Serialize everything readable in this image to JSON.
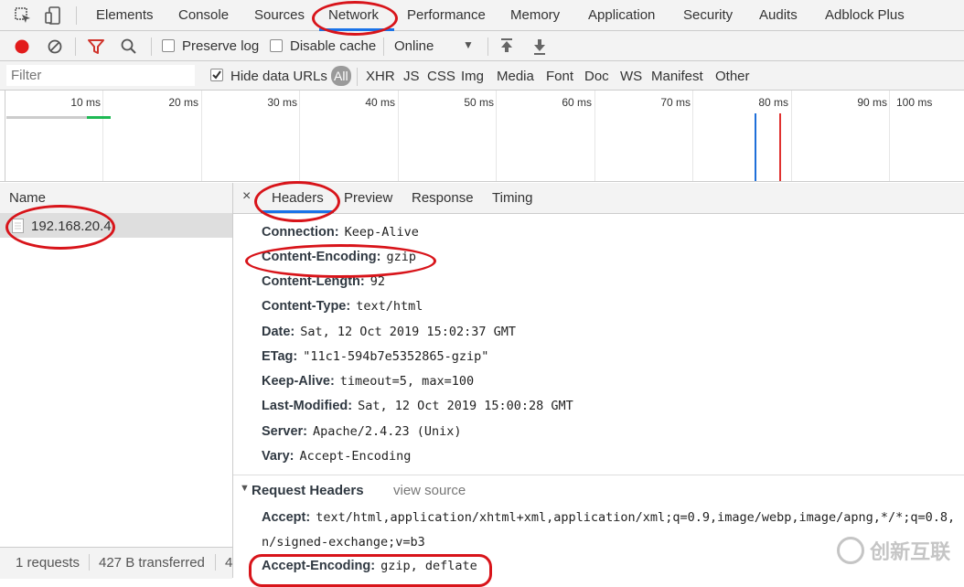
{
  "tabs": [
    "Elements",
    "Console",
    "Sources",
    "Network",
    "Performance",
    "Memory",
    "Application",
    "Security",
    "Audits",
    "Adblock Plus"
  ],
  "toolbar": {
    "preserve_log": "Preserve log",
    "disable_cache": "Disable cache",
    "throttle": "Online"
  },
  "filter": {
    "placeholder": "Filter",
    "hide_data_urls": "Hide data URLs",
    "types": [
      "All",
      "XHR",
      "JS",
      "CSS",
      "Img",
      "Media",
      "Font",
      "Doc",
      "WS",
      "Manifest",
      "Other"
    ]
  },
  "timeline": {
    "ticks": [
      "10 ms",
      "20 ms",
      "30 ms",
      "40 ms",
      "50 ms",
      "60 ms",
      "70 ms",
      "80 ms",
      "90 ms",
      "100 ms"
    ]
  },
  "name_pane": {
    "header": "Name",
    "request": "192.168.20.4"
  },
  "detail_tabs": [
    "Headers",
    "Preview",
    "Response",
    "Timing"
  ],
  "response_headers": [
    {
      "k": "Connection:",
      "v": "Keep-Alive"
    },
    {
      "k": "Content-Encoding:",
      "v": "gzip"
    },
    {
      "k": "Content-Length:",
      "v": "92"
    },
    {
      "k": "Content-Type:",
      "v": "text/html"
    },
    {
      "k": "Date:",
      "v": "Sat, 12 Oct 2019 15:02:37 GMT"
    },
    {
      "k": "ETag:",
      "v": "\"11c1-594b7e5352865-gzip\""
    },
    {
      "k": "Keep-Alive:",
      "v": "timeout=5, max=100"
    },
    {
      "k": "Last-Modified:",
      "v": "Sat, 12 Oct 2019 15:00:28 GMT"
    },
    {
      "k": "Server:",
      "v": "Apache/2.4.23 (Unix)"
    },
    {
      "k": "Vary:",
      "v": "Accept-Encoding"
    }
  ],
  "request_section": {
    "title": "Request Headers",
    "view_source": "view source"
  },
  "request_headers": {
    "accept_key": "Accept:",
    "accept_value": "text/html,application/xhtml+xml,application/xml;q=0.9,image/webp,image/apng,*/*;q=0.8,",
    "accept_cont": "n/signed-exchange;v=b3",
    "enc_key": "Accept-Encoding:",
    "enc_value": "gzip, deflate"
  },
  "status": {
    "requests": "1 requests",
    "transferred": "427 B transferred",
    "more": "4"
  },
  "watermark": "创新互联",
  "colors": {
    "record": "#e21b1b",
    "filter_active": "#d0342c",
    "annotation": "#d8141a",
    "all_badge": "#9a9a9a"
  }
}
